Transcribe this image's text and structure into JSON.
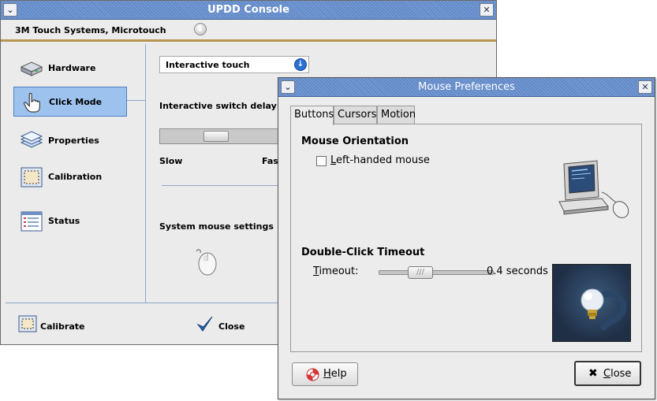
{
  "updd": {
    "title": "UPDD Console",
    "device": "3M Touch Systems, Microtouch",
    "nav": [
      {
        "label": "Hardware",
        "icon": "hardware-icon"
      },
      {
        "label": "Click Mode",
        "icon": "hand-pointer-icon",
        "selected": true
      },
      {
        "label": "Properties",
        "icon": "layers-icon"
      },
      {
        "label": "Calibration",
        "icon": "calibration-icon"
      },
      {
        "label": "Status",
        "icon": "status-list-icon"
      }
    ],
    "mode_value": "Interactive touch",
    "switch_delay_label": "Interactive switch delay",
    "slow_label": "Slow",
    "fast_label": "Fast",
    "system_mouse_label": "System mouse settings",
    "calibrate_label": "Calibrate",
    "close_label": "Close"
  },
  "prefs": {
    "title": "Mouse Preferences",
    "tabs": [
      "Buttons",
      "Cursors",
      "Motion"
    ],
    "active_tab": "Buttons",
    "orientation_heading": "Mouse Orientation",
    "left_handed_label": "Left-handed mouse",
    "left_handed_checked": false,
    "dbl_click_heading": "Double-Click Timeout",
    "timeout_label": "Timeout:",
    "timeout_value": "0.4 seconds",
    "help_label": "Help",
    "close_label": "Close"
  },
  "colors": {
    "titlebar": "#6a8fca",
    "selection": "#9ec2ee",
    "separator": "#b89552"
  }
}
